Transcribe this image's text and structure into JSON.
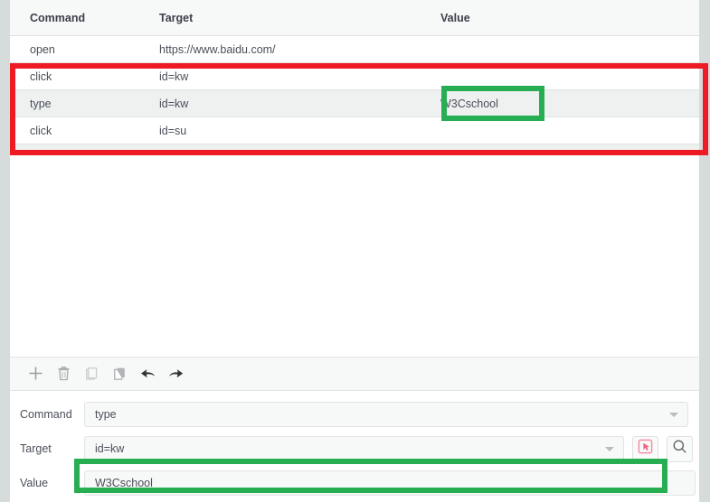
{
  "table": {
    "columns": [
      "Command",
      "Target",
      "Value"
    ],
    "rows": [
      {
        "command": "open",
        "target": "https://www.baidu.com/",
        "value": ""
      },
      {
        "command": "click",
        "target": "id=kw",
        "value": ""
      },
      {
        "command": "type",
        "target": "id=kw",
        "value": "W3Cschool"
      },
      {
        "command": "click",
        "target": "id=su",
        "value": ""
      }
    ]
  },
  "toolbar": {
    "buttons": [
      {
        "name": "add-command-button",
        "icon": "plus-icon",
        "label": "Add command"
      },
      {
        "name": "delete-command-button",
        "icon": "trash-icon",
        "label": "Delete command"
      },
      {
        "name": "copy-command-button",
        "icon": "copy-icon",
        "label": "Copy command"
      },
      {
        "name": "paste-command-button",
        "icon": "paste-icon",
        "label": "Paste command"
      },
      {
        "name": "undo-button",
        "icon": "undo-arrow-icon",
        "label": "Undo"
      },
      {
        "name": "redo-button",
        "icon": "redo-arrow-icon",
        "label": "Redo"
      }
    ]
  },
  "form": {
    "command": {
      "label": "Command",
      "value": "type",
      "placeholder": ""
    },
    "target": {
      "label": "Target",
      "value": "id=kw",
      "placeholder": ""
    },
    "value": {
      "label": "Value",
      "value": "W3Cschool",
      "placeholder": ""
    },
    "select_target_button": {
      "name": "select-target-button",
      "icon": "target-select-icon"
    },
    "find_target_button": {
      "name": "find-target-button",
      "icon": "search-icon"
    }
  },
  "annotations": {
    "highlight_rows": {
      "color": "#ed1c24",
      "note": "click / type / click rows"
    },
    "highlight_value_cell": {
      "color": "#27ae52",
      "note": "W3Cschool value cell"
    },
    "highlight_value_field": {
      "color": "#27ae52",
      "note": "W3Cschool value input"
    }
  },
  "colors": {
    "page_background": "#d6dbdc",
    "panel_background": "#ffffff",
    "row_alt_background": "#eef1f0",
    "header_background": "#f7f8f8",
    "text": "#4a4f58",
    "annotation_red": "#ed1c24",
    "annotation_green": "#27ae52",
    "select_target_accent": "#f48fa5"
  }
}
